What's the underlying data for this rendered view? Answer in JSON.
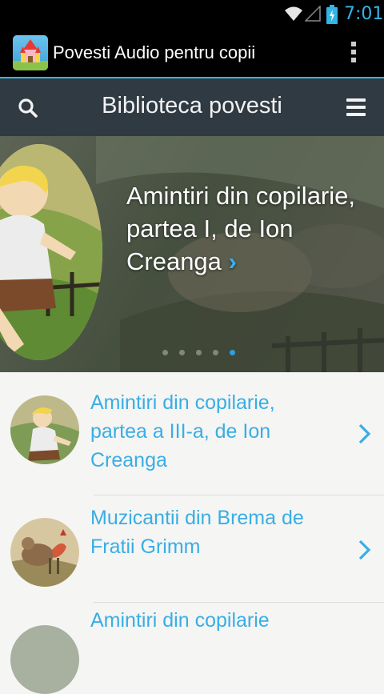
{
  "status_bar": {
    "time": "7:01",
    "icons": [
      "wifi-icon",
      "signal-icon",
      "battery-charging-icon"
    ],
    "accent": "#33b5e5"
  },
  "action_bar": {
    "title": "Povesti Audio pentru copii",
    "icons": [
      "app-icon",
      "overflow-menu-icon"
    ]
  },
  "header": {
    "title": "Biblioteca povesti",
    "icons": [
      "search-icon",
      "menu-icon"
    ],
    "background": "#2f3a43"
  },
  "featured": {
    "title": "Amintiri din copilarie, partea I, de Ion Creanga",
    "chevron": "›",
    "slides": 5,
    "active_slide": 5
  },
  "stories": [
    {
      "title": "Amintiri din copilarie, partea a III-a, de Ion Creanga"
    },
    {
      "title": "Muzicantii din Brema de Fratii Grimm"
    },
    {
      "title": "Amintiri din copilarie"
    }
  ],
  "colors": {
    "link": "#38aee4",
    "page_background": "#f5f5f4"
  }
}
